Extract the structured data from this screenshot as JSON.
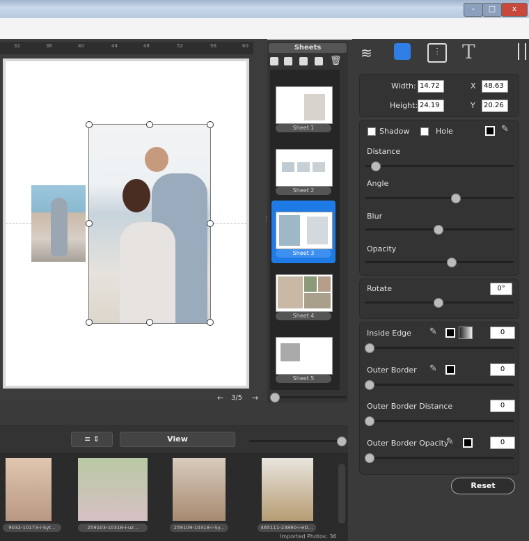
{
  "sheets": {
    "header": "Sheets",
    "items": [
      {
        "label": "Sheet 1"
      },
      {
        "label": "Sheet 2"
      },
      {
        "label": "Sheet 3"
      },
      {
        "label": "Sheet 4"
      },
      {
        "label": "Sheet 5"
      }
    ],
    "page_indicator": "3/5",
    "selected_index": 2
  },
  "ruler": {
    "ticks": [
      "32",
      "36",
      "40",
      "44",
      "48",
      "52",
      "56",
      "60"
    ]
  },
  "properties": {
    "width_label": "Width:",
    "width_value": "14.72",
    "x_label": "X",
    "x_value": "48.63",
    "height_label": "Height:",
    "height_value": "24.19",
    "y_label": "Y",
    "y_value": "20.26",
    "shadow_label": "Shadow",
    "hole_label": "Hole",
    "distance_label": "Distance",
    "angle_label": "Angle",
    "blur_label": "Blur",
    "opacity_label": "Opacity",
    "rotate_label": "Rotate",
    "rotate_value": "0°",
    "inside_edge_label": "Inside Edge",
    "inside_edge_value": "0",
    "outer_border_label": "Outer Border",
    "outer_border_value": "0",
    "outer_border_distance_label": "Outer Border Distance",
    "outer_border_distance_value": "0",
    "outer_border_opacity_label": "Outer Border Opacity",
    "outer_border_opacity_value": "0",
    "reset_label": "Reset"
  },
  "toolbar": {
    "view_label": "View",
    "title_icon_label": "T"
  },
  "window": {
    "min_label": "-",
    "max_label": "□",
    "close_label": "x"
  },
  "filmstrip": {
    "photos": [
      {
        "label": "9032-10173-i-Syt..."
      },
      {
        "label": "259103-10318-i-uz..."
      },
      {
        "label": "259109-10318-i-Sy..."
      },
      {
        "label": "465111-23890-i-eD..."
      }
    ],
    "status": "Imported Photos: 36"
  }
}
